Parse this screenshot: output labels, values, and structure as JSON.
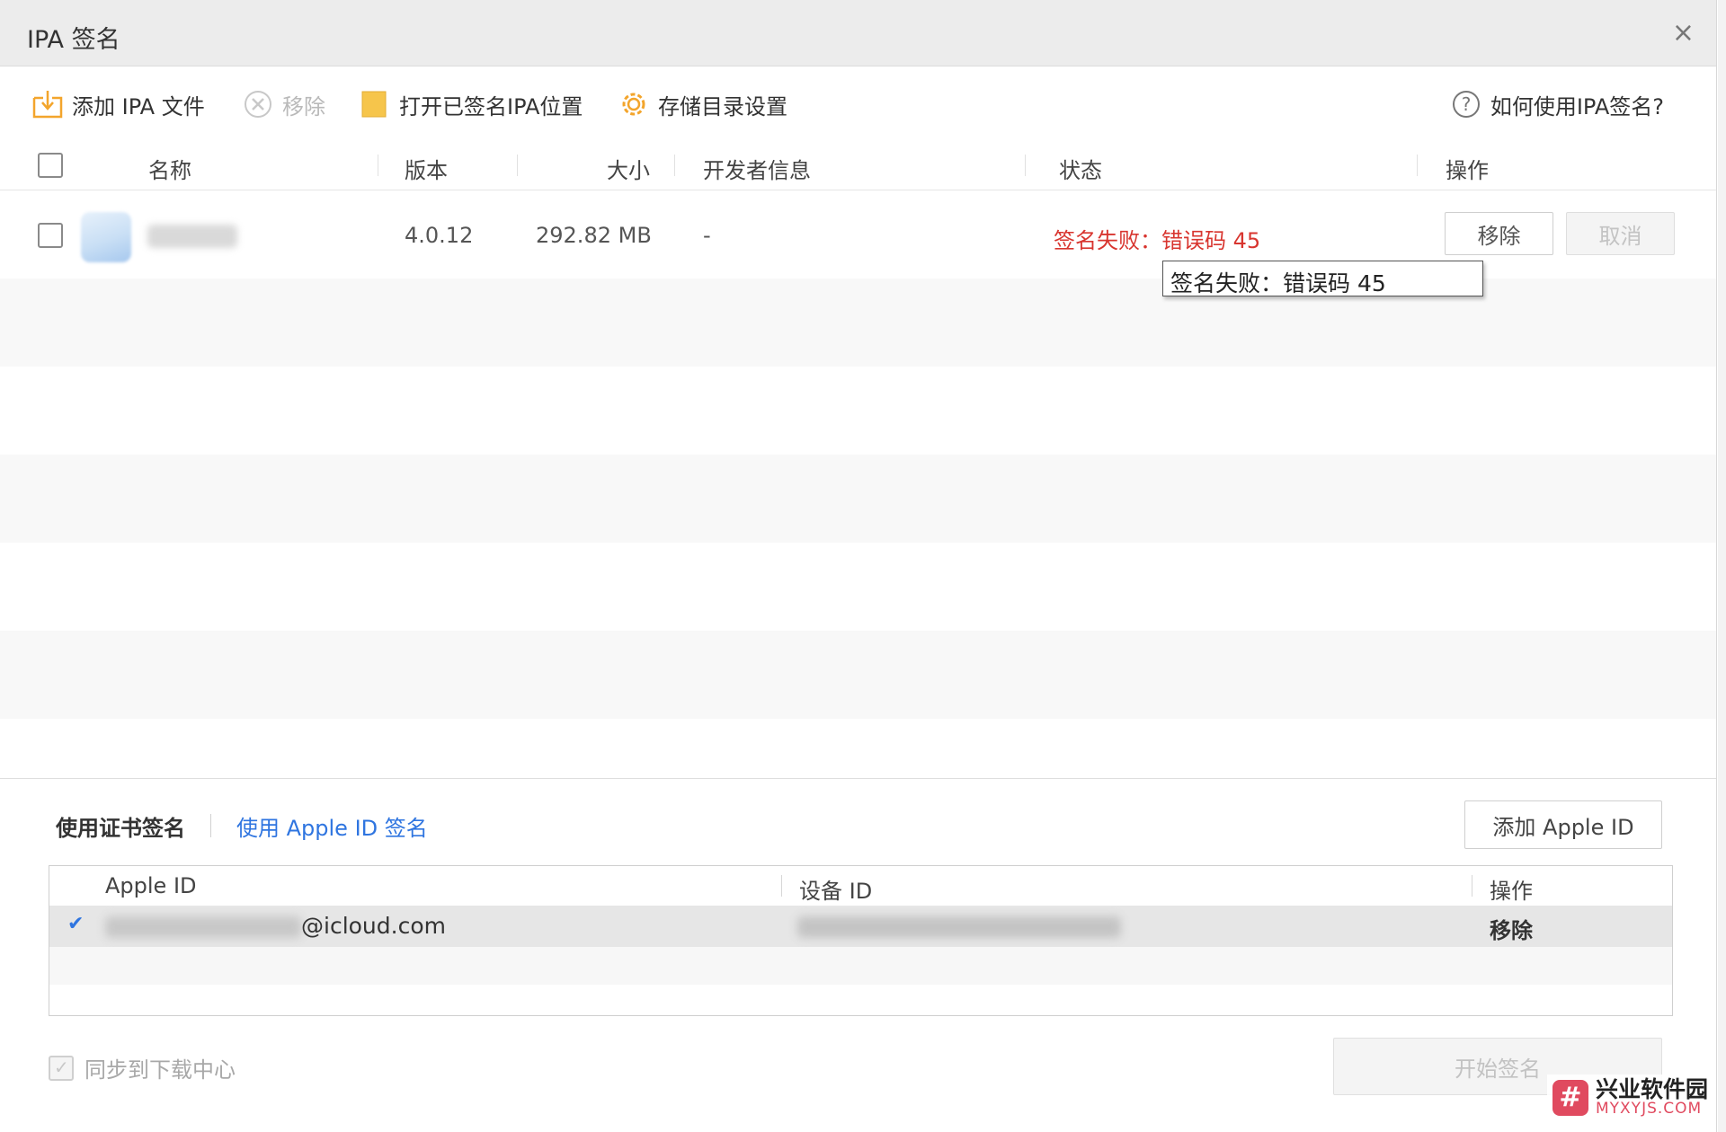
{
  "window": {
    "title": "IPA 签名",
    "close": "×"
  },
  "toolbar": {
    "add": "添加 IPA 文件",
    "remove": "移除",
    "open_location": "打开已签名IPA位置",
    "storage": "存储目录设置",
    "help": "如何使用IPA签名?"
  },
  "table": {
    "columns": [
      "名称",
      "版本",
      "大小",
      "开发者信息",
      "状态",
      "操作"
    ],
    "rows": [
      {
        "version": "4.0.12",
        "size": "292.82 MB",
        "developer": "-",
        "status": "签名失败：错误码 45",
        "btn_remove": "移除",
        "btn_cancel": "取消"
      }
    ],
    "tooltip": "签名失败：错误码 45"
  },
  "bottom": {
    "tab_cert": "使用证书签名",
    "tab_apple": "使用 Apple ID 签名",
    "add_apple": "添加 Apple ID",
    "id_columns": [
      "Apple ID",
      "设备 ID",
      "操作"
    ],
    "id_rows": [
      {
        "check": "✔",
        "email_suffix": "@icloud.com",
        "action": "移除"
      }
    ],
    "sync": "同步到下载中心",
    "start": "开始签名"
  },
  "watermark": {
    "logo": "#",
    "cn": "兴业软件园",
    "en": "MYXYJS.COM"
  },
  "colors": {
    "error": "#d8352f",
    "link": "#2f75e0",
    "accent_folder": "#f3b73a"
  }
}
